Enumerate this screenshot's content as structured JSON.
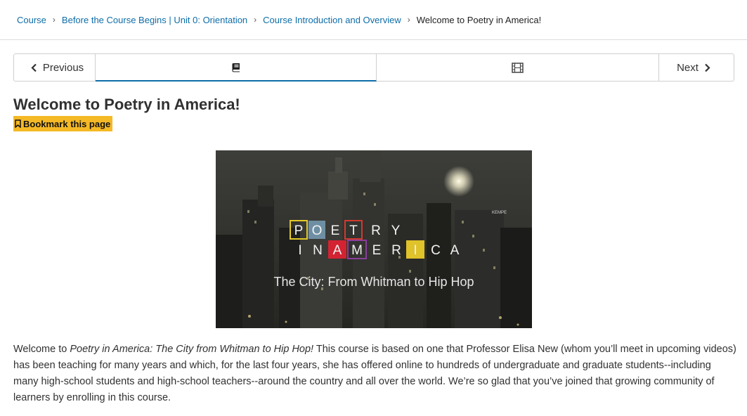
{
  "breadcrumb": {
    "items": [
      "Course",
      "Before the Course Begins | Unit 0: Orientation",
      "Course Introduction and Overview"
    ],
    "current": "Welcome to Poetry in America!"
  },
  "sequence_nav": {
    "previous_label": "Previous",
    "next_label": "Next",
    "tabs": [
      {
        "icon": "book-icon",
        "active": true
      },
      {
        "icon": "film-icon",
        "active": false
      }
    ]
  },
  "page": {
    "title": "Welcome to Poetry in America!",
    "bookmark_label": "Bookmark this page"
  },
  "hero_image": {
    "logo_line1": [
      "P",
      "O",
      "E",
      "T",
      "R",
      "Y"
    ],
    "logo_line2": [
      "I",
      "N",
      "A",
      "M",
      "E",
      "R",
      "I",
      "C",
      "A"
    ],
    "subtitle": "The City: From Whitman to Hip Hop",
    "building_sign": "KEMPE"
  },
  "intro": {
    "lead": "Welcome to ",
    "course_title": "Poetry in America: The City from Whitman to Hip Hop!",
    "rest": " This course is based on one that Professor Elisa New (whom you’ll meet in upcoming videos) has been teaching for many years and which, for the last four years, she has offered online to hundreds of undergraduate and graduate students--including many high-school students and high-school teachers--around the country and all over the world. We’re so glad that you’ve joined that growing community of learners by enrolling in this course."
  },
  "colors": {
    "link": "#0e6da8",
    "bookmark_bg": "#f5b926",
    "active_tab_border": "#0e6da8"
  }
}
